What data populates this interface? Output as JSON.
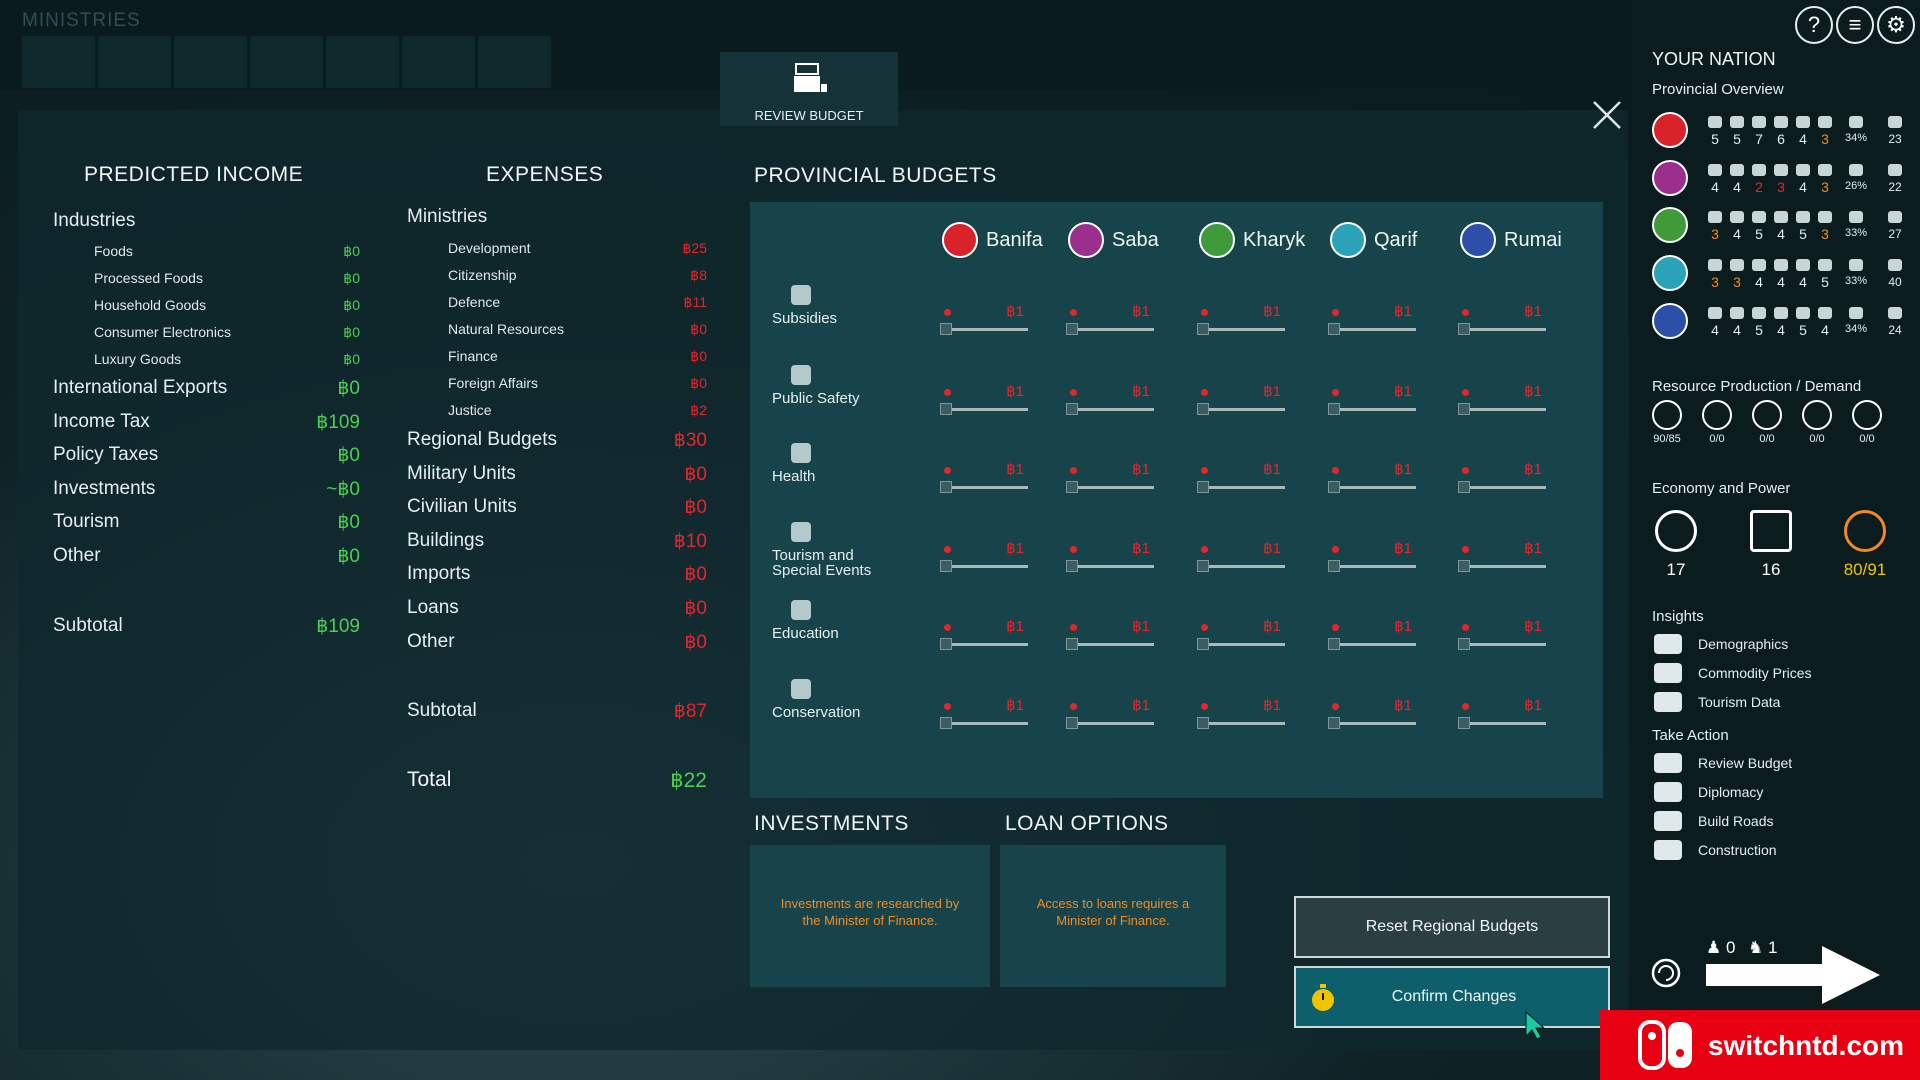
{
  "topbar": {
    "title": "MINISTRIES"
  },
  "review_tab": {
    "label": "REVIEW BUDGET"
  },
  "income": {
    "heading": "PREDICTED INCOME",
    "industries_label": "Industries",
    "industries": [
      {
        "label": "Foods",
        "value": "฿0"
      },
      {
        "label": "Processed Foods",
        "value": "฿0"
      },
      {
        "label": "Household Goods",
        "value": "฿0"
      },
      {
        "label": "Consumer Electronics",
        "value": "฿0"
      },
      {
        "label": "Luxury Goods",
        "value": "฿0"
      }
    ],
    "rows": [
      {
        "label": "International Exports",
        "value": "฿0"
      },
      {
        "label": "Income Tax",
        "value": "฿109"
      },
      {
        "label": "Policy Taxes",
        "value": "฿0"
      },
      {
        "label": "Investments",
        "value": "~฿0"
      },
      {
        "label": "Tourism",
        "value": "฿0"
      },
      {
        "label": "Other",
        "value": "฿0"
      }
    ],
    "subtotal_label": "Subtotal",
    "subtotal_value": "฿109"
  },
  "expenses": {
    "heading": "EXPENSES",
    "ministries_label": "Ministries",
    "ministries": [
      {
        "label": "Development",
        "value": "฿25"
      },
      {
        "label": "Citizenship",
        "value": "฿8"
      },
      {
        "label": "Defence",
        "value": "฿11"
      },
      {
        "label": "Natural Resources",
        "value": "฿0"
      },
      {
        "label": "Finance",
        "value": "฿0"
      },
      {
        "label": "Foreign Affairs",
        "value": "฿0"
      },
      {
        "label": "Justice",
        "value": "฿2"
      }
    ],
    "rows": [
      {
        "label": "Regional Budgets",
        "value": "฿30"
      },
      {
        "label": "Military Units",
        "value": "฿0"
      },
      {
        "label": "Civilian Units",
        "value": "฿0"
      },
      {
        "label": "Buildings",
        "value": "฿10"
      },
      {
        "label": "Imports",
        "value": "฿0"
      },
      {
        "label": "Loans",
        "value": "฿0"
      },
      {
        "label": "Other",
        "value": "฿0"
      }
    ],
    "subtotal_label": "Subtotal",
    "subtotal_value": "฿87",
    "total_label": "Total",
    "total_value": "฿22"
  },
  "provincial": {
    "heading": "PROVINCIAL BUDGETS",
    "provinces": [
      {
        "name": "Banifa",
        "color": "#d8232a"
      },
      {
        "name": "Saba",
        "color": "#9b2f8e"
      },
      {
        "name": "Kharyk",
        "color": "#3f9b3a"
      },
      {
        "name": "Qarif",
        "color": "#2aa2b8"
      },
      {
        "name": "Rumai",
        "color": "#2d4fa8"
      }
    ],
    "categories": [
      {
        "label": "Subsidies",
        "icon": "chart-bars-icon"
      },
      {
        "label": "Public Safety",
        "icon": "shield-icon"
      },
      {
        "label": "Health",
        "icon": "heart-icon"
      },
      {
        "label": "Tourism and Special Events",
        "icon": "masks-icon"
      },
      {
        "label": "Education",
        "icon": "graduation-cap-icon"
      },
      {
        "label": "Conservation",
        "icon": "leaf-icon"
      }
    ],
    "cell_amount": "฿1"
  },
  "investments": {
    "heading": "INVESTMENTS",
    "message": "Investments are researched by the Minister of Finance."
  },
  "loans": {
    "heading": "LOAN OPTIONS",
    "message": "Access to loans requires a Minister of Finance."
  },
  "buttons": {
    "reset": "Reset Regional Budgets",
    "confirm": "Confirm Changes"
  },
  "sidebar": {
    "heading": "YOUR NATION",
    "provincial_overview": "Provincial Overview",
    "overview_rows": [
      {
        "vals": [
          "5",
          "5",
          "7",
          "6",
          "4",
          "3"
        ],
        "orange": [
          5
        ],
        "red": [],
        "pct": "34%",
        "count": "23"
      },
      {
        "vals": [
          "4",
          "4",
          "2",
          "3",
          "4",
          "3"
        ],
        "orange": [
          5
        ],
        "red": [
          2,
          3
        ],
        "pct": "26%",
        "count": "22"
      },
      {
        "vals": [
          "3",
          "4",
          "5",
          "4",
          "5",
          "3"
        ],
        "orange": [
          0,
          5
        ],
        "red": [],
        "pct": "33%",
        "count": "27"
      },
      {
        "vals": [
          "3",
          "3",
          "4",
          "4",
          "4",
          "5"
        ],
        "orange": [
          0,
          1
        ],
        "red": [],
        "pct": "33%",
        "count": "40"
      },
      {
        "vals": [
          "4",
          "4",
          "5",
          "4",
          "5",
          "4"
        ],
        "orange": [],
        "red": [],
        "pct": "34%",
        "count": "24"
      }
    ],
    "resource_heading": "Resource Production / Demand",
    "resources": [
      "90/85",
      "0/0",
      "0/0",
      "0/0",
      "0/0"
    ],
    "economy_heading": "Economy and Power",
    "economy": [
      {
        "value": "17",
        "icon": "baht-coin-icon"
      },
      {
        "value": "16",
        "icon": "locked-vault-icon"
      },
      {
        "value": "80/91",
        "icon": "lightning-icon"
      }
    ],
    "insights_heading": "Insights",
    "insights": [
      "Demographics",
      "Commodity Prices",
      "Tourism Data"
    ],
    "action_heading": "Take Action",
    "actions": [
      "Review Budget",
      "Diplomacy",
      "Build Roads",
      "Construction"
    ],
    "turn_counts": [
      "0",
      "1"
    ]
  },
  "banner": {
    "text": "switchntd.com"
  }
}
